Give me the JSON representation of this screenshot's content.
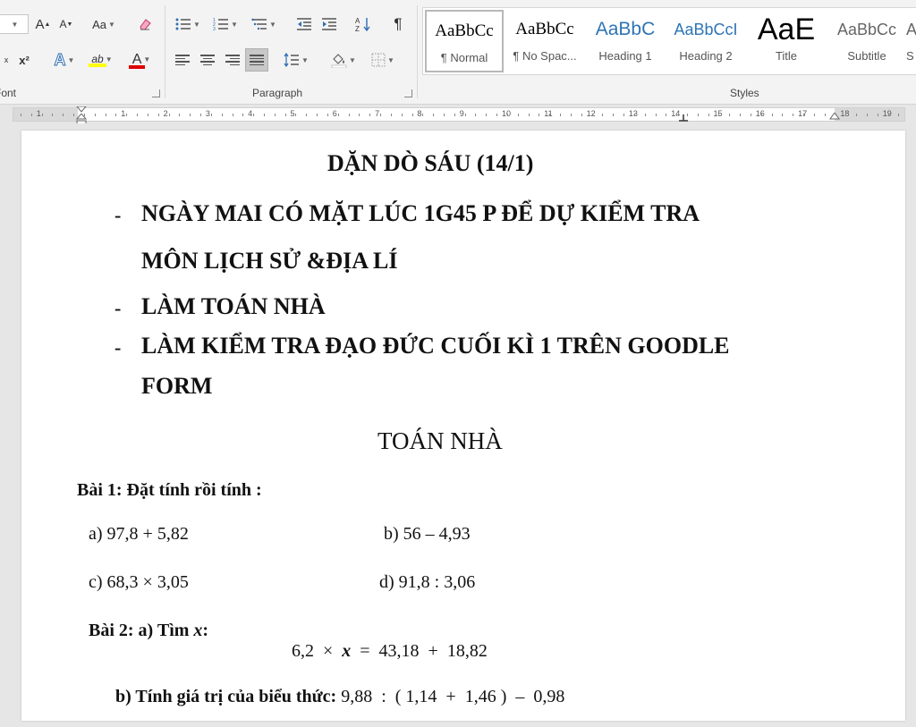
{
  "ribbon": {
    "font": {
      "label": "Font",
      "grow_font": "A",
      "shrink_font": "A",
      "change_case": "Aa",
      "subscript": "x",
      "superscript": "x²",
      "text_effects": "A",
      "highlight": "ab",
      "font_color": "A"
    },
    "paragraph": {
      "label": "Paragraph",
      "show_marks": "¶"
    },
    "styles": {
      "label": "Styles",
      "items": [
        {
          "sample": "AaBbCc",
          "name": "¶ Normal"
        },
        {
          "sample": "AaBbCc",
          "name": "¶ No Spac..."
        },
        {
          "sample": "AaBbC",
          "name": "Heading 1"
        },
        {
          "sample": "AaBbCcI",
          "name": "Heading 2"
        },
        {
          "sample": "AaE",
          "name": "Title"
        },
        {
          "sample": "AaBbCc",
          "name": "Subtitle"
        },
        {
          "sample": "A",
          "name": "S"
        }
      ]
    }
  },
  "ruler": {
    "numbers": [
      "1",
      "1",
      "2",
      "3",
      "4",
      "5",
      "6",
      "7",
      "8",
      "9",
      "10",
      "11",
      "12",
      "13",
      "14",
      "15",
      "16",
      "17",
      "18",
      "19"
    ]
  },
  "document": {
    "title": "DẶN DÒ SÁU (14/1)",
    "bullet_dash": "-",
    "bullets": [
      {
        "lines": [
          "NGÀY MAI CÓ MẶT LÚC 1G45 P ĐỂ DỰ KIỂM TRA",
          "MÔN LỊCH SỬ &ĐỊA LÍ"
        ]
      },
      {
        "lines": [
          "LÀM TOÁN NHÀ"
        ]
      },
      {
        "lines": [
          "LÀM KIỂM TRA ĐẠO ĐỨC CUỐI KÌ 1 TRÊN GOODLE",
          "FORM"
        ]
      }
    ],
    "section_title": "TOÁN NHÀ",
    "bai1": {
      "heading": "Bài 1:  Đặt tính rồi tính :",
      "a": "a)  97,8  +  5,82",
      "b": "b)  56  –  4,93",
      "c": "c)  68,3  ×  3,05",
      "d": "d) 91,8  :  3,06"
    },
    "bai2": {
      "a_label": "Bài 2: a) Tìm ",
      "a_var": "x",
      "a_colon": ":",
      "a_expr_1": "6,2  ×  ",
      "a_expr_var": "x",
      "a_expr_2": "  =  43,18  +  18,82",
      "b_label": "b) Tính giá trị của biểu thức:",
      "b_expr": " 9,88  :  ( 1,14  +  1,46 )  –  0,98"
    }
  }
}
